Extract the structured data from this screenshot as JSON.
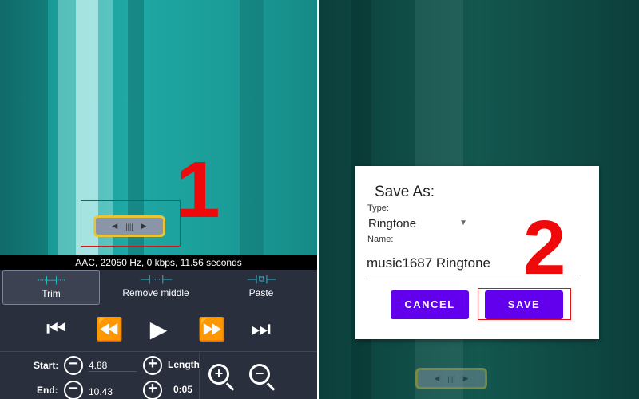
{
  "left": {
    "annotation_number": "1",
    "info_text": "AAC, 22050 Hz, 0 kbps, 11.56 seconds",
    "tools": [
      {
        "label": "Trim",
        "icon": "trim-icon",
        "selected": true
      },
      {
        "label": "Remove middle",
        "icon": "remove-middle-icon"
      },
      {
        "label": "Paste",
        "icon": "paste-icon"
      }
    ],
    "transport": [
      "skip-start-icon",
      "rewind-icon",
      "play-icon",
      "fast-forward-icon",
      "skip-end-icon"
    ],
    "start_label": "Start:",
    "start_value": "4.88",
    "end_label": "End:",
    "end_value": "10.43",
    "length_label": "Length",
    "length_value": "0:05"
  },
  "dialog": {
    "annotation_number": "2",
    "title": "Save As:",
    "type_label": "Type:",
    "type_value": "Ringtone",
    "name_label": "Name:",
    "name_value": "music1687 Ringtone",
    "cancel_label": "CANCEL",
    "save_label": "SAVE"
  },
  "colors": {
    "accent": "#6200ee",
    "highlight": "#e01010",
    "handle": "#e7c43a",
    "tool_icon": "#2bc7cf"
  }
}
